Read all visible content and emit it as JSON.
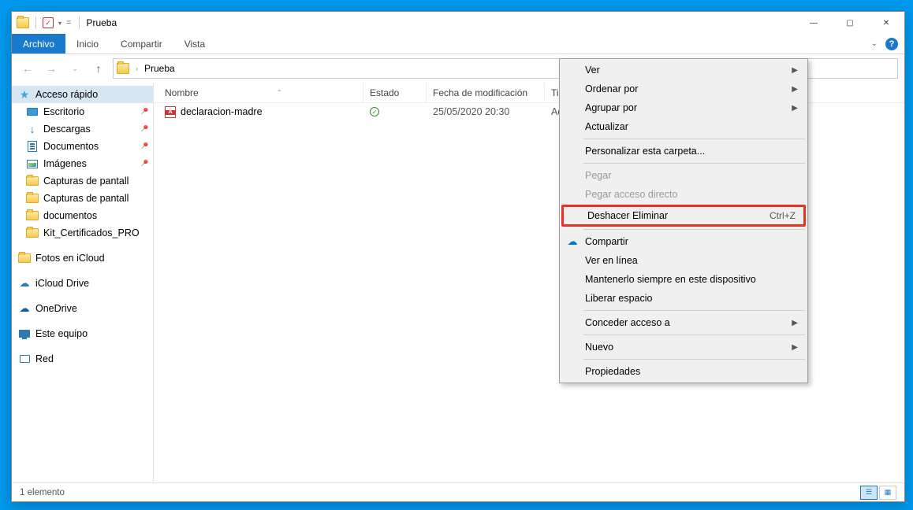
{
  "window": {
    "title": "Prueba",
    "sys": {
      "min": "—",
      "max": "▢",
      "close": "✕"
    }
  },
  "ribbon": {
    "file": "Archivo",
    "home": "Inicio",
    "share": "Compartir",
    "view": "Vista"
  },
  "address": {
    "location": "Prueba",
    "search_placeholder": "Prueba"
  },
  "sidebar": {
    "quick": "Acceso rápido",
    "desktop": "Escritorio",
    "downloads": "Descargas",
    "documents": "Documentos",
    "pictures": "Imágenes",
    "cap1": "Capturas de pantall",
    "cap2": "Capturas de pantall",
    "docs2": "documentos",
    "kit": "Kit_Certificados_PRO",
    "icloud_photos": "Fotos en iCloud",
    "icloud_drive": "iCloud Drive",
    "onedrive": "OneDrive",
    "thispc": "Este equipo",
    "network": "Red"
  },
  "columns": {
    "name": "Nombre",
    "status": "Estado",
    "modified": "Fecha de modificación",
    "type": "Tipo"
  },
  "files": [
    {
      "name": "declaracion-madre",
      "status_ok": true,
      "modified": "25/05/2020 20:30",
      "type": "Adob"
    }
  ],
  "statusbar": {
    "count": "1 elemento"
  },
  "context_menu": {
    "ver": "Ver",
    "ordenar": "Ordenar por",
    "agrupar": "Agrupar por",
    "actualizar": "Actualizar",
    "personalizar": "Personalizar esta carpeta...",
    "pegar": "Pegar",
    "pegar_acceso": "Pegar acceso directo",
    "deshacer": "Deshacer Eliminar",
    "deshacer_key": "Ctrl+Z",
    "compartir": "Compartir",
    "ver_en_linea": "Ver en línea",
    "mantener": "Mantenerlo siempre en este dispositivo",
    "liberar": "Liberar espacio",
    "conceder": "Conceder acceso a",
    "nuevo": "Nuevo",
    "propiedades": "Propiedades"
  }
}
